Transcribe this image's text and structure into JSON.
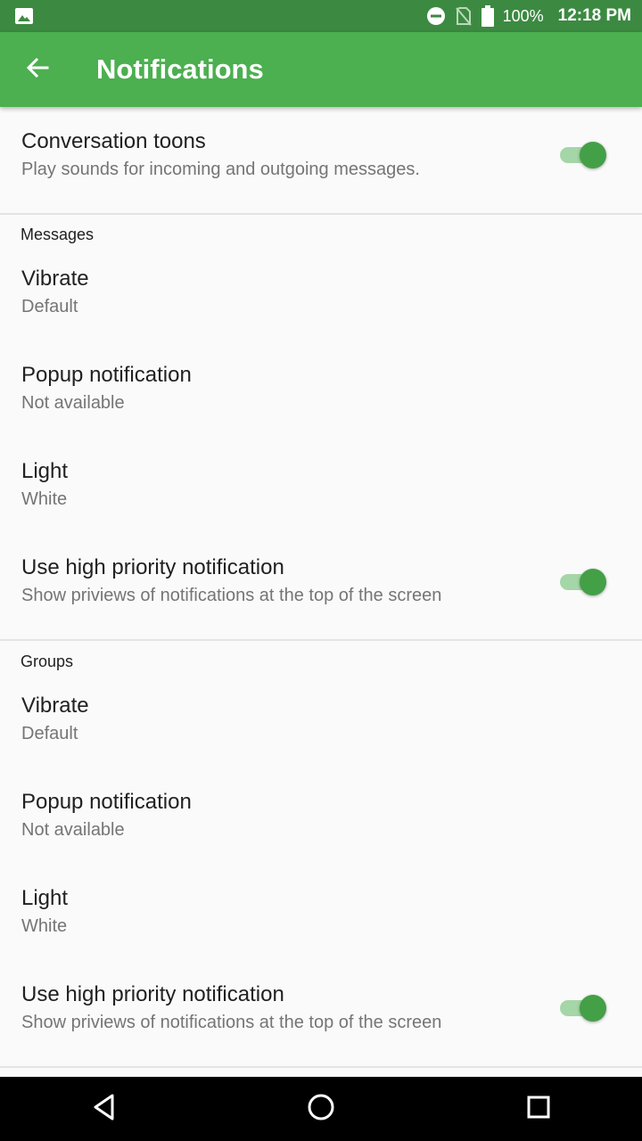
{
  "status_bar": {
    "battery": "100%",
    "time": "12:18 PM",
    "icons": [
      "image-icon",
      "do-not-disturb-icon",
      "no-sim-icon",
      "battery-icon"
    ]
  },
  "app_bar": {
    "title": "Notifications",
    "back_icon": "arrow-back-icon"
  },
  "conversation": {
    "title": "Conversation toons",
    "summary": "Play sounds for incoming and outgoing messages.",
    "enabled": true
  },
  "sections": [
    {
      "header": "Messages",
      "vibrate": {
        "title": "Vibrate",
        "summary": "Default"
      },
      "popup": {
        "title": "Popup notification",
        "summary": "Not available"
      },
      "light": {
        "title": "Light",
        "summary": "White"
      },
      "priority": {
        "title": "Use high priority notification",
        "summary": "Show priviews of notifications at the top of the screen",
        "enabled": true
      }
    },
    {
      "header": "Groups",
      "vibrate": {
        "title": "Vibrate",
        "summary": "Default"
      },
      "popup": {
        "title": "Popup notification",
        "summary": "Not available"
      },
      "light": {
        "title": "Light",
        "summary": "White"
      },
      "priority": {
        "title": "Use high priority notification",
        "summary": "Show priviews of notifications at the top of the screen",
        "enabled": true
      }
    }
  ],
  "nav_bar": {
    "icons": [
      "back-triangle-icon",
      "home-circle-icon",
      "recents-square-icon"
    ]
  },
  "colors": {
    "status_bar": "#3c8a41",
    "app_bar": "#4caf50",
    "toggle_thumb": "#43a047",
    "toggle_track": "#a5d6a7",
    "background": "#fafafa"
  }
}
